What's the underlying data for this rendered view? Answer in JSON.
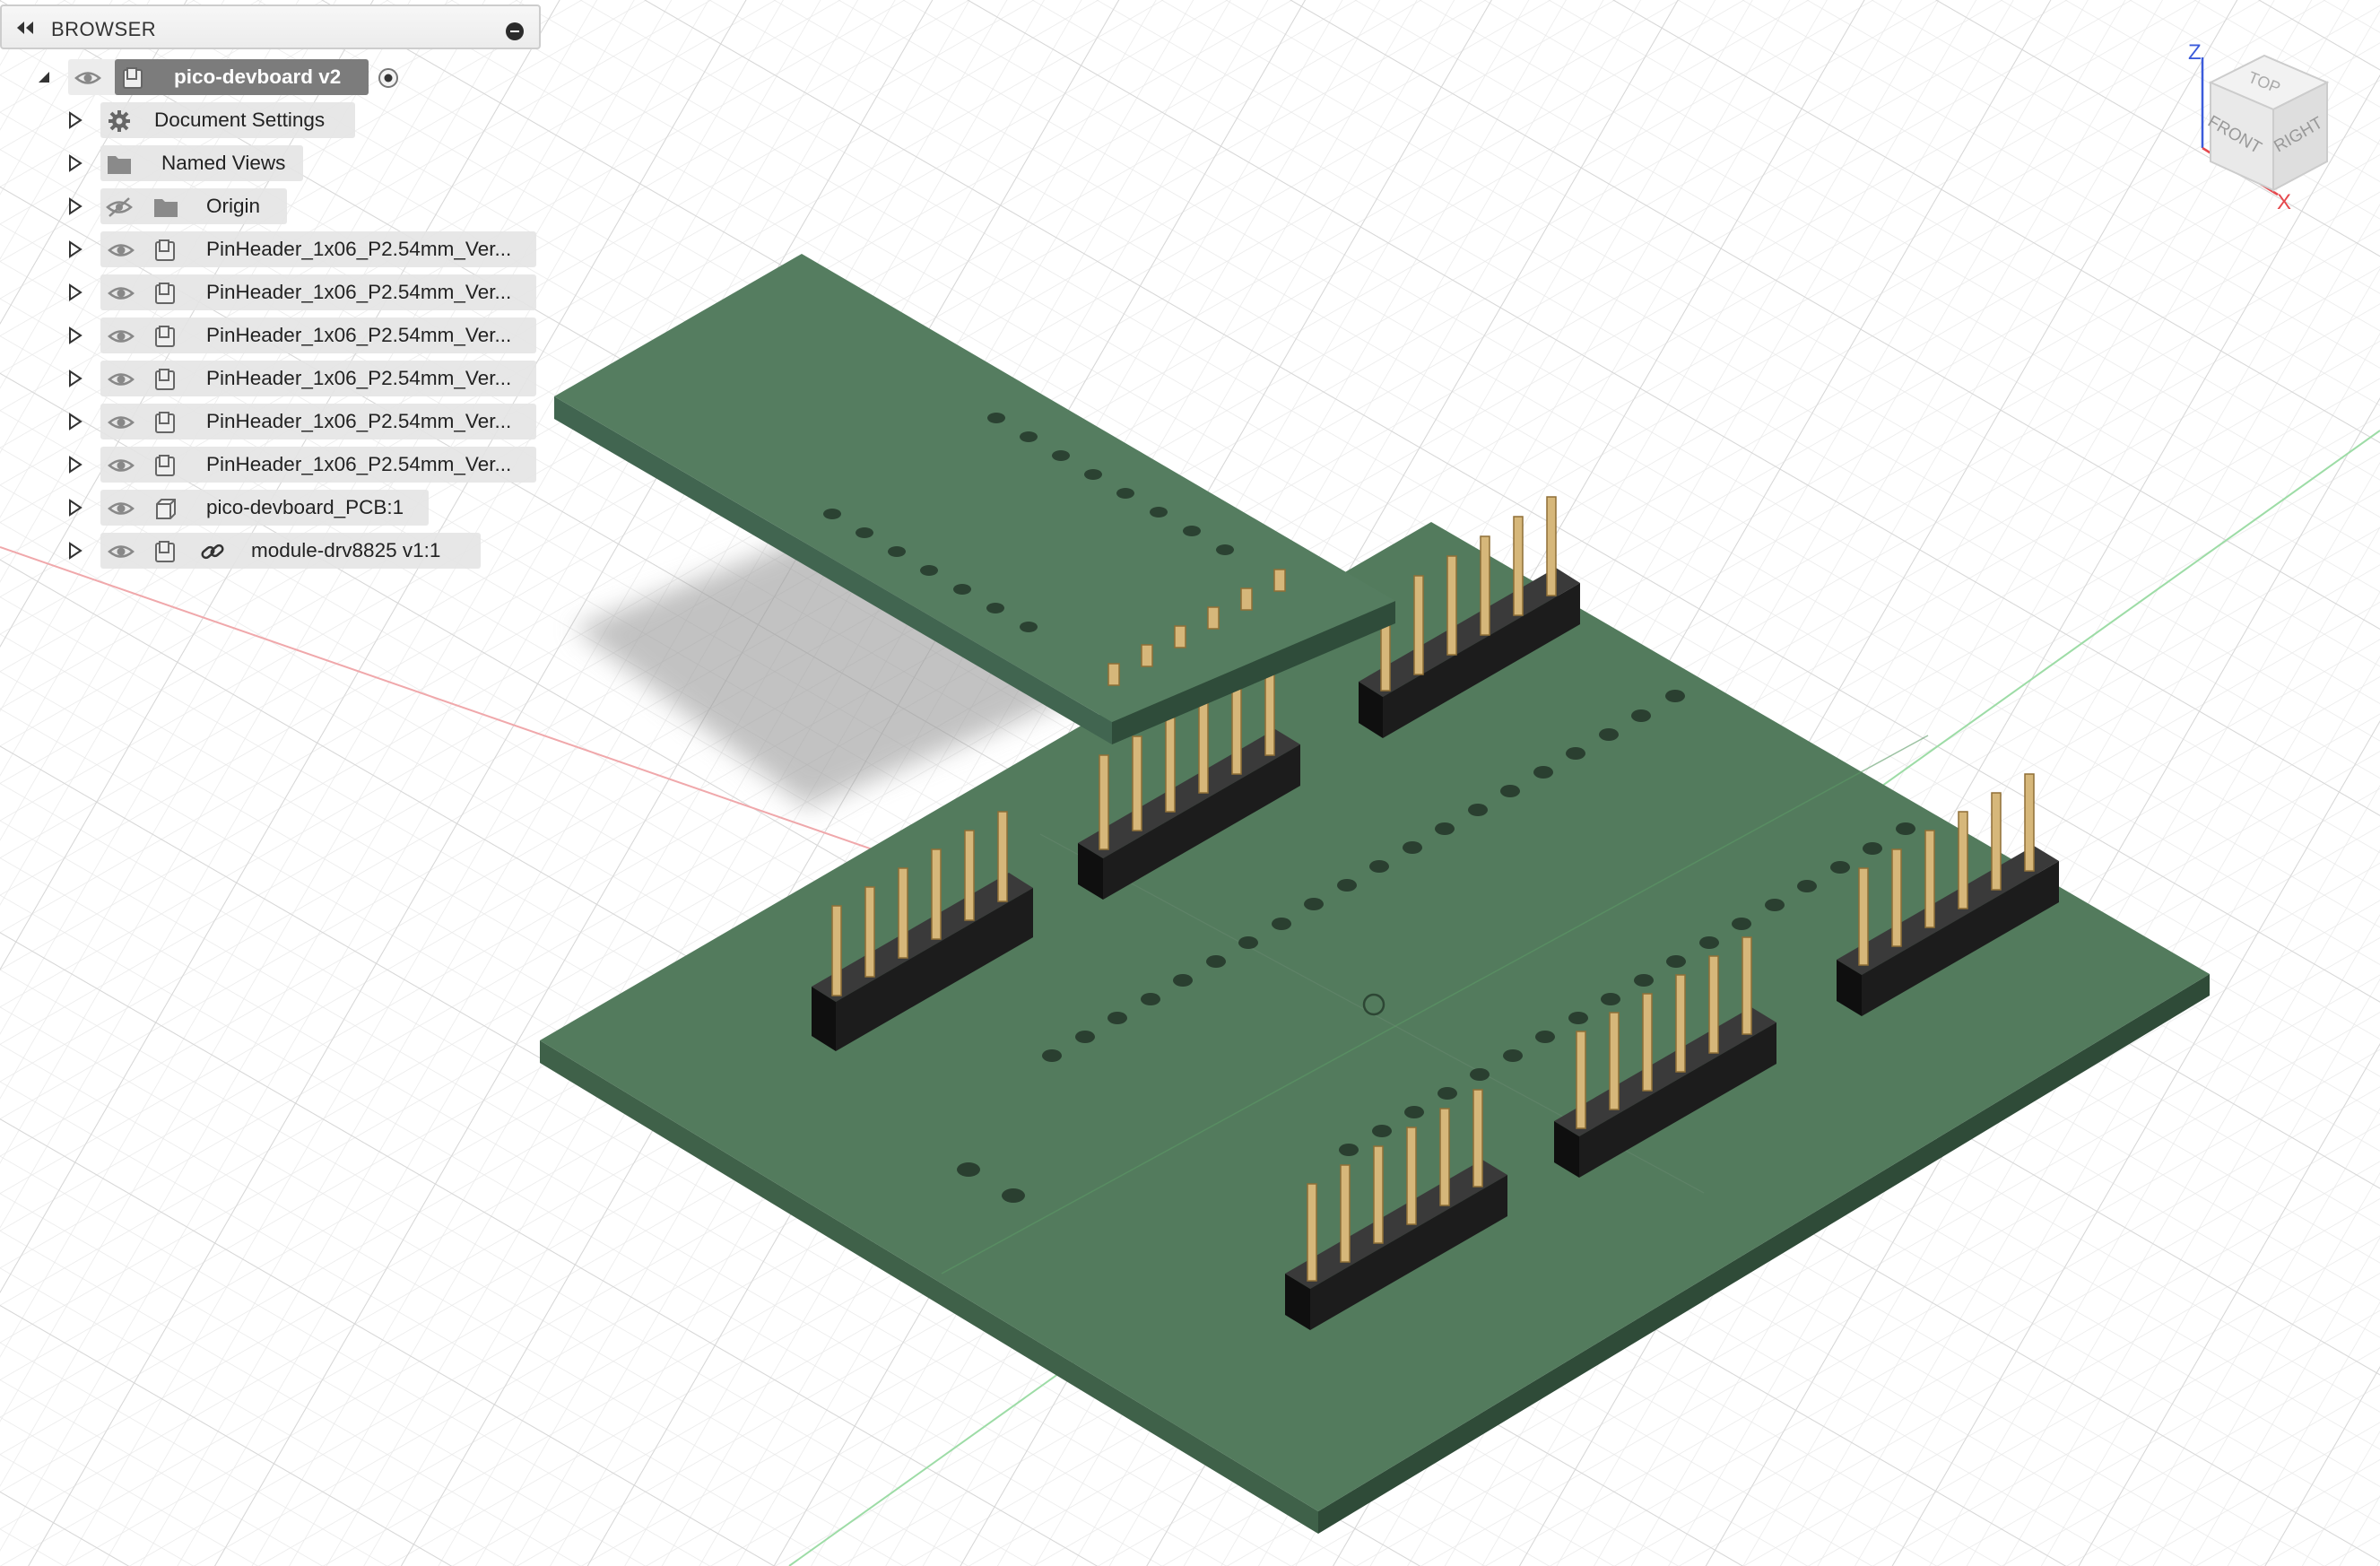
{
  "browser": {
    "title": "BROWSER",
    "root": {
      "label": "pico-devboard v2"
    },
    "items": [
      {
        "label": "Document Settings",
        "icon": "gear-icon"
      },
      {
        "label": "Named Views",
        "icon": "folder-icon"
      },
      {
        "label": "Origin",
        "icon": "folder-icon",
        "visibility": "hidden"
      },
      {
        "label": "PinHeader_1x06_P2.54mm_Ver...",
        "icon": "component-icon"
      },
      {
        "label": "PinHeader_1x06_P2.54mm_Ver...",
        "icon": "component-icon"
      },
      {
        "label": "PinHeader_1x06_P2.54mm_Ver...",
        "icon": "component-icon"
      },
      {
        "label": "PinHeader_1x06_P2.54mm_Ver...",
        "icon": "component-icon"
      },
      {
        "label": "PinHeader_1x06_P2.54mm_Ver...",
        "icon": "component-icon"
      },
      {
        "label": "PinHeader_1x06_P2.54mm_Ver...",
        "icon": "component-icon"
      },
      {
        "label": "pico-devboard_PCB:1",
        "icon": "body-icon"
      },
      {
        "label": "module-drv8825 v1:1",
        "icon": "component-icon",
        "linked": true
      }
    ]
  },
  "viewcube": {
    "top": "TOP",
    "front": "FRONT",
    "right": "RIGHT",
    "axis_z": "Z",
    "axis_x": "X"
  },
  "colors": {
    "pcb_top": "#527a5c",
    "pcb_side": "#3d6048",
    "header_body": "#1e1e1e",
    "pin": "#c9a66a",
    "axis_x": "#e5484d",
    "axis_y": "#38b24a",
    "axis_z": "#3b5bdb"
  }
}
